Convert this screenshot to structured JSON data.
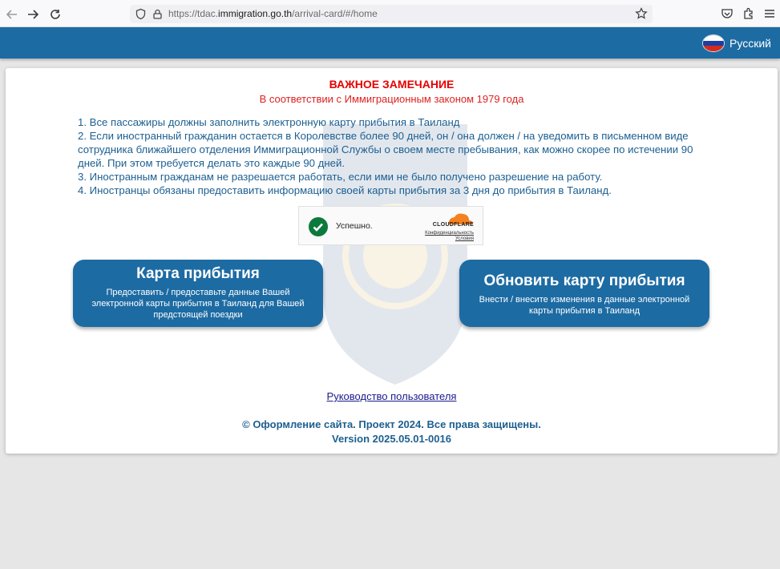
{
  "browser": {
    "url_prefix": "https://tdac.",
    "url_domain": "immigration.go.th",
    "url_path": "/arrival-card/#/home"
  },
  "header": {
    "language_label": "Русский",
    "flag_colors": [
      "#ffffff",
      "#1c3fa0",
      "#d52b1e"
    ]
  },
  "notice": {
    "title": "ВАЖНОЕ ЗАМЕЧАНИЕ",
    "subtitle": "В соответствии с Иммиграционным законом 1979 года",
    "rules": [
      "1. Все пассажиры должны заполнить электронную карту прибытия в Таиланд",
      "2. Если иностранный гражданин остается в Королевстве более 90 дней, он / она должен / на уведомить в письменном виде сотрудника ближайшего отделения Иммиграционной Службы о своем месте пребывания, как можно скорее по истечении 90 дней. При этом требуется делать это каждые 90 дней.",
      "3. Иностранным гражданам не разрешается работать, если ими не было получено разрешение на работу.",
      "4. Иностранцы обязаны предоставить информацию своей карты прибытия за 3 дня до прибытия в Таиланд."
    ]
  },
  "captcha": {
    "status": "Успешно.",
    "brand": "CLOUDFLARE",
    "privacy_link": "Конфиденциальность",
    "terms_link": "Условия"
  },
  "actions": {
    "arrival_card": {
      "title": "Карта прибытия",
      "description": "Предоставить / предоставьте данные Вашей электронной карты прибытия в Таиланд для Вашей предстоящей поездки"
    },
    "update_card": {
      "title": "Обновить карту прибытия",
      "description": "Внести / внесите изменения в данные электронной карты прибытия в Таиланд"
    }
  },
  "links": {
    "user_guide": "Руководство пользователя"
  },
  "footer": {
    "copyright": "© Оформление сайта. Проект 2024. Все права защищены.",
    "version": "Version 2025.05.01-0016"
  },
  "colors": {
    "brand_blue": "#1d6ba3",
    "notice_red": "#e60000",
    "text_blue": "#1c5f91"
  }
}
